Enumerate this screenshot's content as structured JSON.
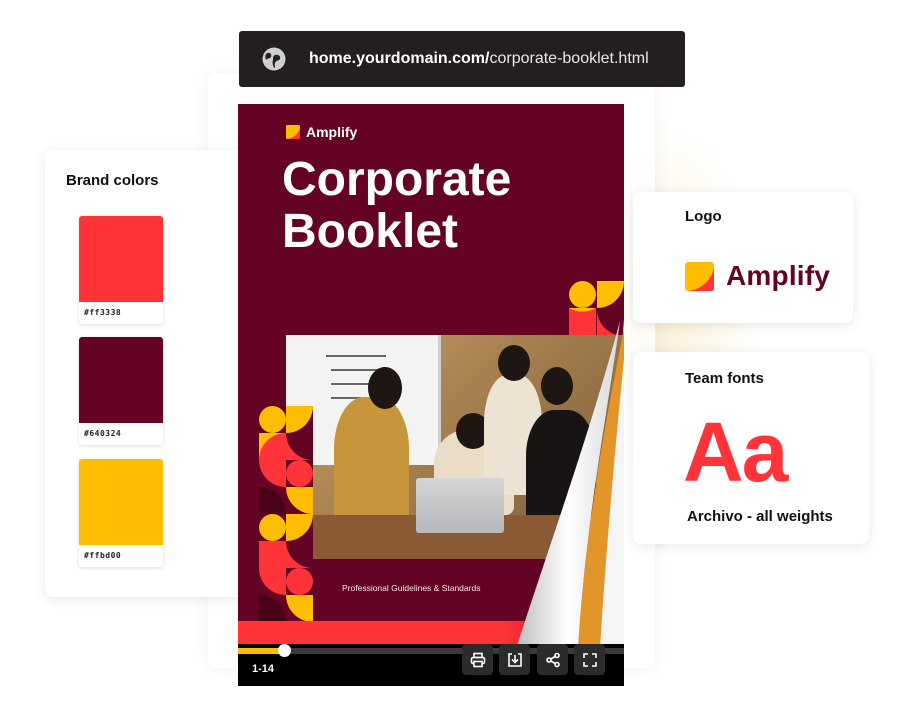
{
  "address_bar": {
    "icon": "globe-icon",
    "domain": "home.yourdomain.com/",
    "path": "corporate-booklet.html"
  },
  "brand_colors": {
    "title": "Brand colors",
    "swatches": [
      {
        "hex": "#ff3338",
        "label": "#ff3338"
      },
      {
        "hex": "#640324",
        "label": "#640324"
      },
      {
        "hex": "#ffbd00",
        "label": "#ffbd00"
      }
    ]
  },
  "logo_card": {
    "title": "Logo",
    "logo_icon": "amplify-logo-icon",
    "wordmark": "Amplify"
  },
  "fonts_card": {
    "title": "Team fonts",
    "sample": "Aa",
    "font_name": "Archivo - all weights"
  },
  "booklet": {
    "brand_name": "Amplify",
    "title_line1": "Corporate",
    "title_line2": "Booklet",
    "subtitle": "Professional Guidelines & Standards",
    "photo_alt": "Team of four people gathered around a laptop in an office"
  },
  "viewer_controls": {
    "page_indicator": "1-14",
    "progress_fraction": 0.12,
    "buttons": [
      {
        "name": "print",
        "icon": "print-icon"
      },
      {
        "name": "download",
        "icon": "download-icon"
      },
      {
        "name": "share",
        "icon": "share-icon"
      },
      {
        "name": "fullscreen",
        "icon": "fullscreen-icon"
      }
    ]
  },
  "colors": {
    "red": "#ff3338",
    "maroon": "#640324",
    "yellow": "#ffbd00"
  }
}
